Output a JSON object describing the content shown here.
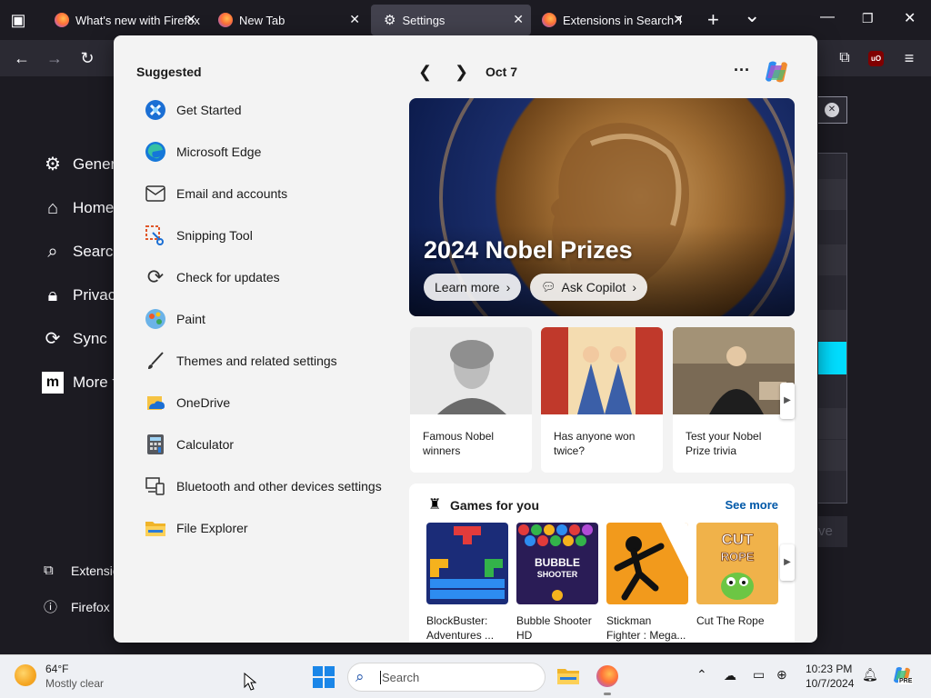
{
  "browser": {
    "tabs": [
      {
        "title": "What's new with Firefox",
        "active": false
      },
      {
        "title": "New Tab",
        "active": false
      },
      {
        "title": "Settings",
        "active": true
      },
      {
        "title": "Extensions in Search To",
        "active": false
      }
    ],
    "new_tab": "+",
    "tab_list": "⌄",
    "addon_badge": "uO"
  },
  "settings_nav": {
    "items": [
      {
        "label": "Genera",
        "icon": "gear-icon"
      },
      {
        "label": "Home",
        "icon": "home-icon"
      },
      {
        "label": "Search",
        "icon": "search-icon"
      },
      {
        "label": "Privacy",
        "icon": "lock-icon"
      },
      {
        "label": "Sync",
        "icon": "sync-icon"
      },
      {
        "label": "More f",
        "icon": "mozilla-icon"
      }
    ],
    "bottom": [
      {
        "label": "Extensio",
        "icon": "puzzle-icon"
      },
      {
        "label": "Firefox S",
        "icon": "help-icon"
      }
    ],
    "faded_button": "ve"
  },
  "start_menu": {
    "suggested_title": "Suggested",
    "suggested": [
      {
        "label": "Get Started",
        "icon": "get-started-icon"
      },
      {
        "label": "Microsoft Edge",
        "icon": "edge-icon"
      },
      {
        "label": "Email and accounts",
        "icon": "mail-icon"
      },
      {
        "label": "Snipping Tool",
        "icon": "scissors-icon"
      },
      {
        "label": "Check for updates",
        "icon": "refresh-icon"
      },
      {
        "label": "Paint",
        "icon": "paint-icon"
      },
      {
        "label": "Themes and related settings",
        "icon": "brush-icon"
      },
      {
        "label": "OneDrive",
        "icon": "onedrive-icon"
      },
      {
        "label": "Calculator",
        "icon": "calculator-icon"
      },
      {
        "label": "Bluetooth and other devices settings",
        "icon": "devices-icon"
      },
      {
        "label": "File Explorer",
        "icon": "folder-icon"
      }
    ],
    "date": "Oct 7",
    "hero": {
      "title": "2024 Nobel Prizes",
      "learn_more": "Learn more",
      "ask_copilot": "Ask Copilot"
    },
    "cards": [
      {
        "caption": "Famous Nobel winners"
      },
      {
        "caption": "Has anyone won twice?"
      },
      {
        "caption": "Test your Nobel Prize trivia"
      }
    ],
    "games": {
      "title": "Games for you",
      "see_more": "See more",
      "items": [
        {
          "caption": "BlockBuster: Adventures ..."
        },
        {
          "caption": "Bubble Shooter HD",
          "art_text": "BUBBLE SHOOTER"
        },
        {
          "caption": "Stickman Fighter : Mega..."
        },
        {
          "caption": "Cut The Rope",
          "art_text": "CUT the ROPE"
        }
      ]
    }
  },
  "taskbar": {
    "weather_temp": "64°F",
    "weather_desc": "Mostly clear",
    "search_placeholder": "Search",
    "time": "10:23 PM",
    "date": "10/7/2024",
    "copilot_badge": "PRE"
  }
}
